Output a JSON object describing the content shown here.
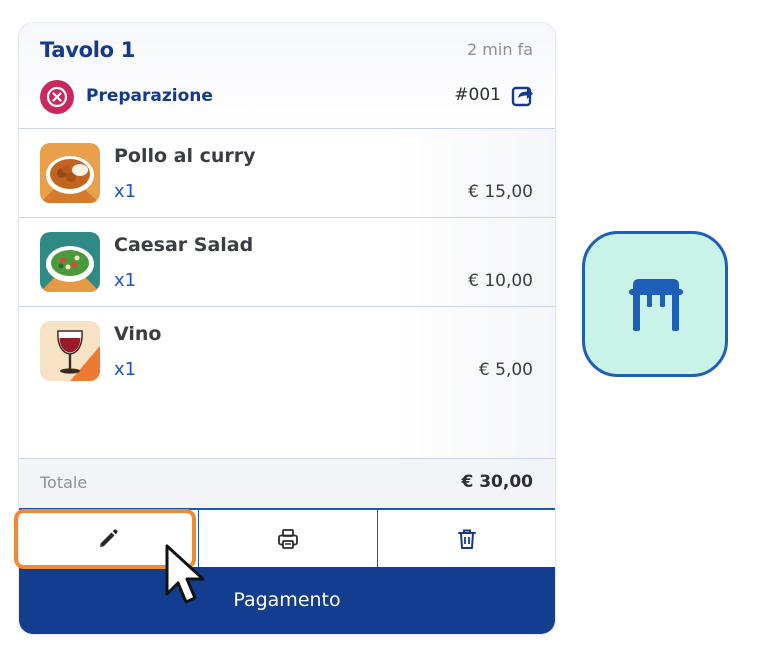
{
  "order_card": {
    "table_name": "Tavolo 1",
    "time_ago": "2 min fa",
    "status": {
      "label": "Preparazione",
      "icon": "x-circle-icon",
      "color": "#c8285e"
    },
    "order_number": "#001",
    "share_icon": "share-icon",
    "items": [
      {
        "name": "Pollo al curry",
        "qty": "x1",
        "price": "€ 15,00",
        "image": "curry-dish-image"
      },
      {
        "name": "Caesar Salad",
        "qty": "x1",
        "price": "€ 10,00",
        "image": "salad-dish-image"
      },
      {
        "name": "Vino",
        "qty": "x1",
        "price": "€ 5,00",
        "image": "wine-glass-image"
      }
    ],
    "total_label": "Totale",
    "total_value": "€ 30,00",
    "actions": [
      {
        "name": "edit",
        "icon": "pencil-icon"
      },
      {
        "name": "print",
        "icon": "printer-icon"
      },
      {
        "name": "delete",
        "icon": "trash-icon"
      }
    ],
    "pay_label": "Pagamento"
  },
  "side_button": {
    "icon": "table-icon",
    "background": "#c9f2e8",
    "border": "#1e5fb7"
  },
  "colors": {
    "primary": "#143a8c",
    "pay_button": "#133d8f",
    "accent_blue": "#1f55b4",
    "highlight": "#ef8a34"
  }
}
